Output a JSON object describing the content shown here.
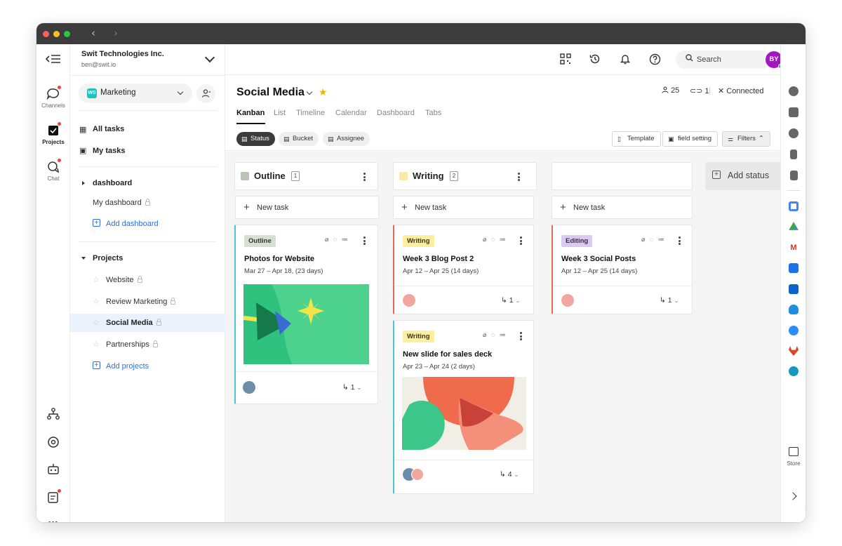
{
  "org": {
    "name": "Swit Technologies Inc.",
    "email": "ben@swit.io"
  },
  "rail": {
    "items": [
      {
        "label": "Channels"
      },
      {
        "label": "Projects"
      },
      {
        "label": "Chat"
      }
    ],
    "more": "•••"
  },
  "workspace": {
    "badge": "WS",
    "name": "Marketing"
  },
  "sidebar": {
    "all_tasks": "All tasks",
    "my_tasks": "My tasks",
    "dashboard_section": "dashboard",
    "my_dashboard": "My dashboard",
    "add_dashboard": "Add dashboard",
    "projects_section": "Projects",
    "projects": [
      {
        "name": "Website"
      },
      {
        "name": "Review Marketing"
      },
      {
        "name": "Social Media"
      },
      {
        "name": "Partnerships"
      }
    ],
    "add_projects": "Add projects"
  },
  "topbar": {
    "search_placeholder": "Search",
    "user_initials": "BY"
  },
  "project": {
    "title": "Social Media",
    "members": "25",
    "links": "1",
    "status": "Connected",
    "tabs": [
      "Kanban",
      "List",
      "Timeline",
      "Calendar",
      "Dashboard",
      "Tabs"
    ],
    "group_by": [
      "Status",
      "Bucket",
      "Assignee"
    ],
    "buttons": {
      "template": "Template",
      "field_setting": "field setting",
      "filters": "Filters"
    }
  },
  "board": {
    "new_task": "New task",
    "add_status": "Add status",
    "columns": [
      {
        "name": "Outline",
        "count": "1",
        "color": "#b9c4b4",
        "cards": [
          {
            "tag": "Outline",
            "tag_color": "#d8dfd2",
            "title": "Photos for Website",
            "dates": "Mar 27 – Apr 18, (23 days)",
            "subtasks": "1",
            "accent": "#4cc6cf"
          }
        ]
      },
      {
        "name": "Writing",
        "count": "2",
        "color": "#faeaa5",
        "cards": [
          {
            "tag": "Writing",
            "tag_color": "#fcef9f",
            "title": "Week 3 Blog Post 2",
            "dates": "Apr 12 – Apr 25 (14 days)",
            "subtasks": "1",
            "accent": "#e06a5c"
          },
          {
            "tag": "Writing",
            "tag_color": "#fcef9f",
            "title": "New slide for sales deck",
            "dates": "Apr 23 – Apr 24 (2 days)",
            "subtasks": "4",
            "accent": "#4cc6cf"
          }
        ]
      },
      {
        "name": "",
        "count": "",
        "color": "",
        "cards": [
          {
            "tag": "Editing",
            "tag_color": "#dcc9f2",
            "title": "Week 3 Social Posts",
            "dates": "Apr 12 – Apr 25 (14 days)",
            "subtasks": "1",
            "accent": "#e06a5c"
          }
        ]
      }
    ]
  },
  "right_rail": {
    "store": "Store"
  }
}
